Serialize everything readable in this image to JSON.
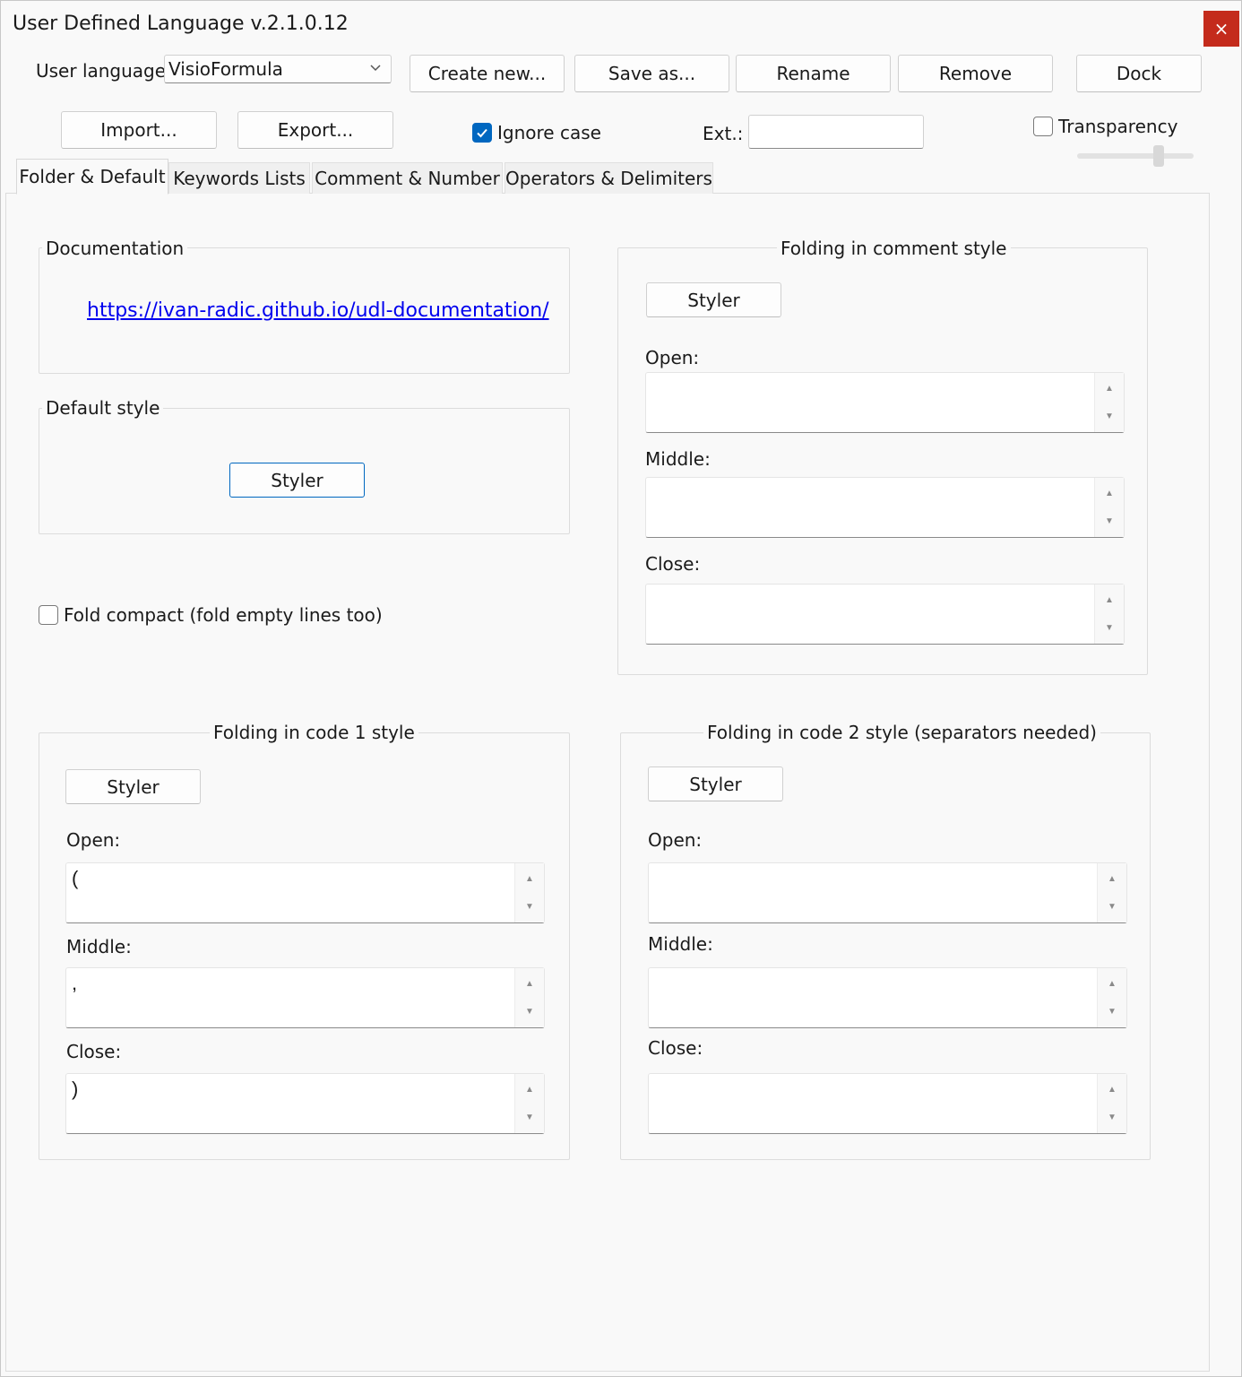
{
  "window": {
    "title": "User Defined Language v.2.1.0.12",
    "close_label": "×"
  },
  "toolbar": {
    "user_language_label": "User language:",
    "user_language_value": "VisioFormula",
    "create_new": "Create new...",
    "save_as": "Save as...",
    "rename": "Rename",
    "remove": "Remove",
    "dock": "Dock",
    "import": "Import...",
    "export": "Export...",
    "ignore_case": "Ignore case",
    "ignore_case_checked": true,
    "ext_label": "Ext.:",
    "ext_value": "",
    "transparency": "Transparency",
    "transparency_checked": false
  },
  "tabs": [
    {
      "label": "Folder & Default",
      "active": true
    },
    {
      "label": "Keywords Lists",
      "active": false
    },
    {
      "label": "Comment & Number",
      "active": false
    },
    {
      "label": "Operators & Delimiters",
      "active": false
    }
  ],
  "documentation": {
    "title": "Documentation",
    "link": "https://ivan-radic.github.io/udl-documentation/"
  },
  "default_style": {
    "title": "Default style",
    "styler": "Styler"
  },
  "fold_compact": {
    "label": "Fold compact (fold empty lines too)",
    "checked": false
  },
  "folding_comment": {
    "title": "Folding in comment style",
    "styler": "Styler",
    "open_label": "Open:",
    "open_value": "",
    "middle_label": "Middle:",
    "middle_value": "",
    "close_label": "Close:",
    "close_value": ""
  },
  "folding_code1": {
    "title": "Folding in code 1 style",
    "styler": "Styler",
    "open_label": "Open:",
    "open_value": "(",
    "middle_label": "Middle:",
    "middle_value": ",",
    "close_label": "Close:",
    "close_value": ")"
  },
  "folding_code2": {
    "title": "Folding in code 2 style (separators needed)",
    "styler": "Styler",
    "open_label": "Open:",
    "open_value": "",
    "middle_label": "Middle:",
    "middle_value": "",
    "close_label": "Close:",
    "close_value": ""
  },
  "icons": {
    "scroll_up": "▲",
    "scroll_down": "▼",
    "dropdown": "⌄",
    "check": "✓"
  },
  "colors": {
    "accent": "#0067c0",
    "close_red": "#c42b1c",
    "link": "#0000ee"
  }
}
